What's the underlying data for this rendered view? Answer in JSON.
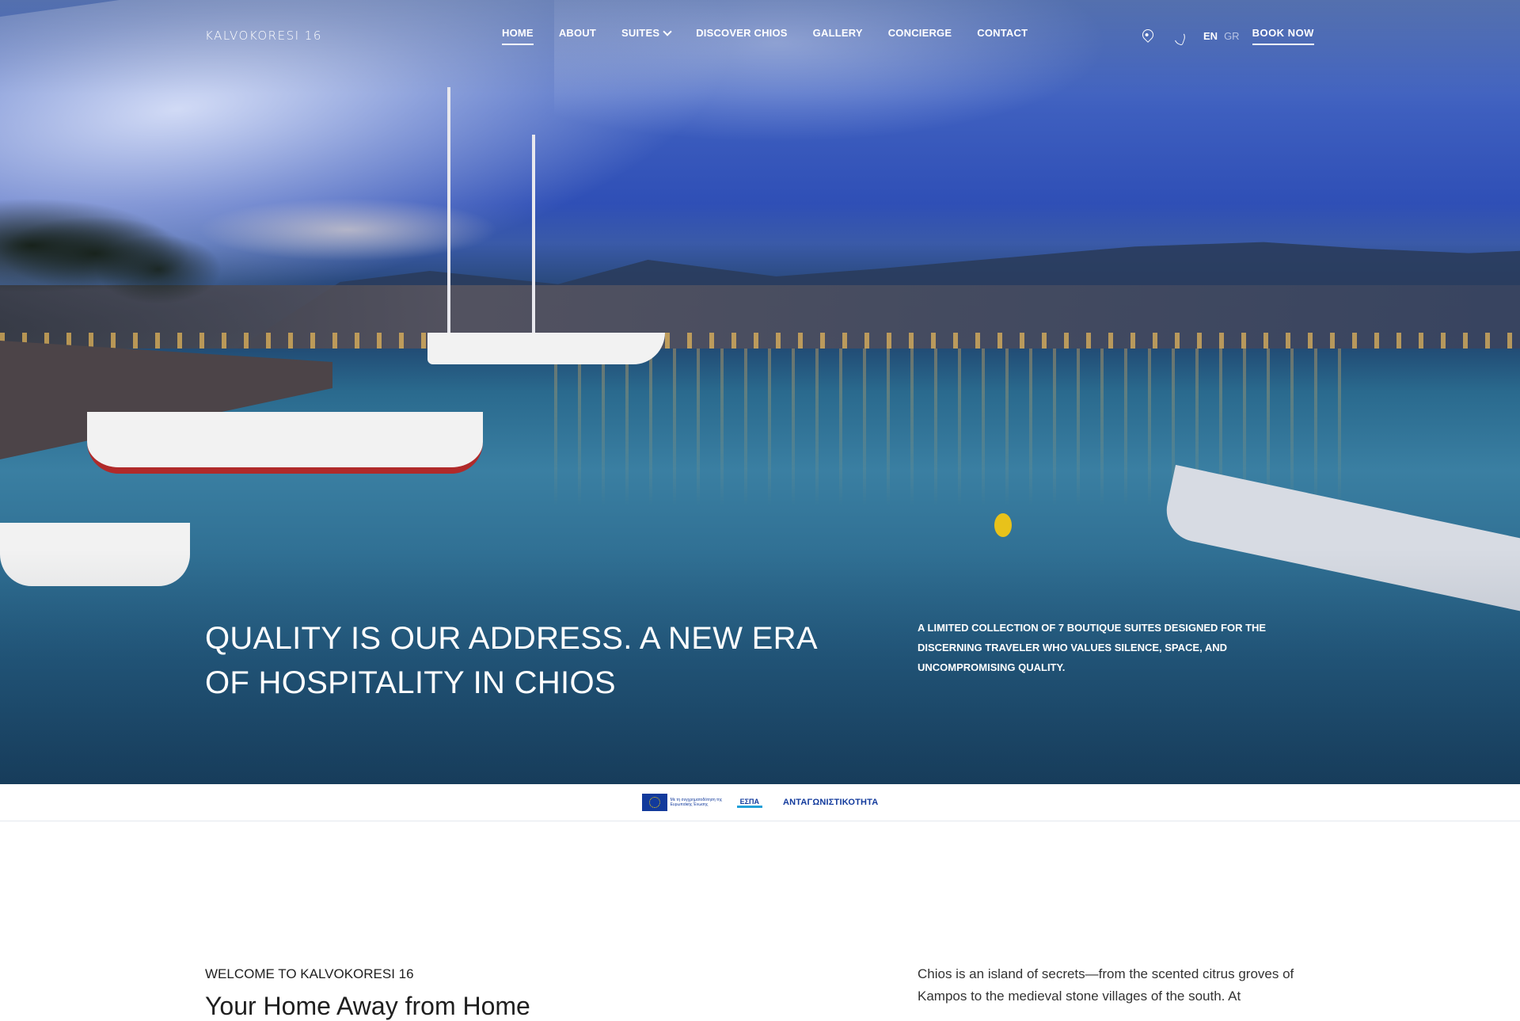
{
  "brand": {
    "logo_text": "KALVOKORESI 16"
  },
  "nav": {
    "items": [
      {
        "label": "HOME",
        "active": true
      },
      {
        "label": "ABOUT"
      },
      {
        "label": "SUITES",
        "has_dropdown": true
      },
      {
        "label": "DISCOVER CHIOS"
      },
      {
        "label": "GALLERY"
      },
      {
        "label": "CONCIERGE"
      },
      {
        "label": "CONTACT"
      }
    ],
    "icons": [
      "map-pin-icon",
      "phone-icon"
    ],
    "lang_en": "EN",
    "lang_gr": "GR",
    "book_now": "BOOK NOW"
  },
  "hero": {
    "headline_line1": "QUALITY IS OUR ADDRESS. A NEW ERA",
    "headline_line2": "OF HOSPITALITY IN CHIOS",
    "subline_line1": "A LIMITED COLLECTION OF 7 BOUTIQUE SUITES DESIGNED FOR THE",
    "subline_line2": "DISCERNING TRAVELER WHO VALUES SILENCE, SPACE, AND",
    "subline_line3": "UNCOMPROMISING QUALITY."
  },
  "funding": {
    "eu_text": "Με τη συγχρηματοδότηση της Ευρωπαϊκής Ένωσης",
    "espa": "ΕΣΠΑ",
    "program": "ΑΝΤΑΓΩΝΙΣΤΙΚΟΤΗΤΑ"
  },
  "welcome": {
    "kicker": "WELCOME TO KALVOKORESI 16",
    "title": "Your Home Away from Home",
    "intro_line1": "Chios is an island of secrets—from the scented citrus groves of",
    "intro_line2": "Kampos to the medieval stone villages of the south. At"
  },
  "colors": {
    "text_dark": "#1f1f1f",
    "white": "#ffffff",
    "eu_blue": "#123a9c"
  }
}
